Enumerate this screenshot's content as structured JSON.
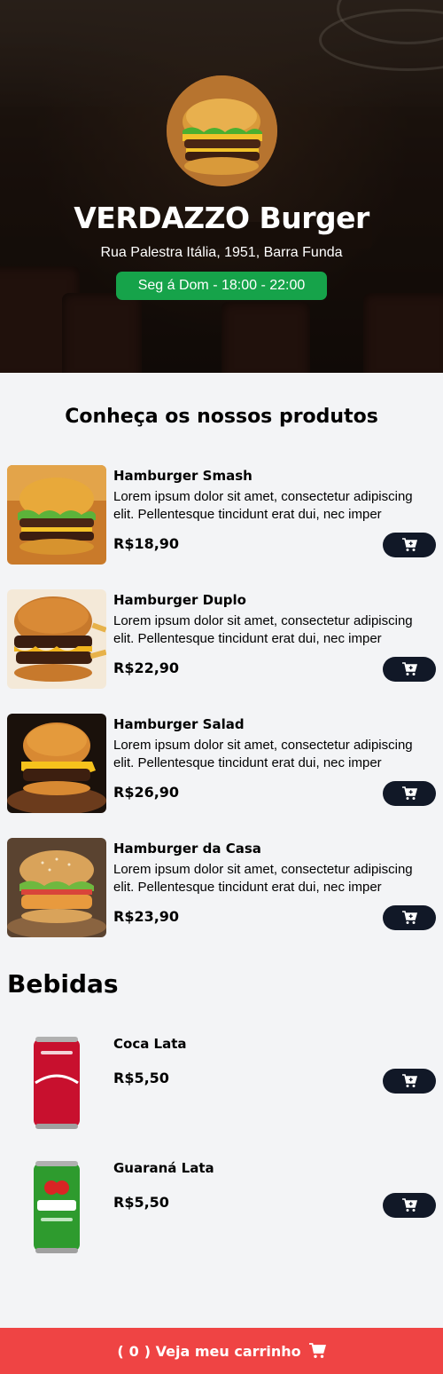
{
  "header": {
    "title": "VERDAZZO Burger",
    "address": "Rua Palestra Itália, 1951, Barra Funda",
    "hours": "Seg á Dom - 18:00 - 22:00"
  },
  "menu": {
    "section_title": "Conheça os nossos produtos",
    "items": [
      {
        "name": "Hamburger Smash",
        "desc": "Lorem ipsum dolor sit amet, consectetur adipiscing elit. Pellentesque tincidunt erat dui, nec imper",
        "price": "R$18,90"
      },
      {
        "name": "Hamburger Duplo",
        "desc": "Lorem ipsum dolor sit amet, consectetur adipiscing elit. Pellentesque tincidunt erat dui, nec imper",
        "price": "R$22,90"
      },
      {
        "name": "Hamburger Salad",
        "desc": "Lorem ipsum dolor sit amet, consectetur adipiscing elit. Pellentesque tincidunt erat dui, nec imper",
        "price": "R$26,90"
      },
      {
        "name": "Hamburger da Casa",
        "desc": "Lorem ipsum dolor sit amet, consectetur adipiscing elit. Pellentesque tincidunt erat dui, nec imper",
        "price": "R$23,90"
      }
    ]
  },
  "drinks": {
    "section_title": "Bebidas",
    "items": [
      {
        "name": "Coca Lata",
        "price": "R$5,50"
      },
      {
        "name": "Guaraná Lata",
        "price": "R$5,50"
      }
    ]
  },
  "footer": {
    "open_paren": "(",
    "count": "0",
    "close_label": ") Veja meu carrinho"
  },
  "icons": {
    "cart": "cart-plus-icon",
    "footer_cart": "shopping-cart-icon"
  },
  "colors": {
    "hours_badge": "#16a34a",
    "cart_button": "#111827",
    "footer": "#ef4444",
    "background": "#f3f4f6"
  }
}
